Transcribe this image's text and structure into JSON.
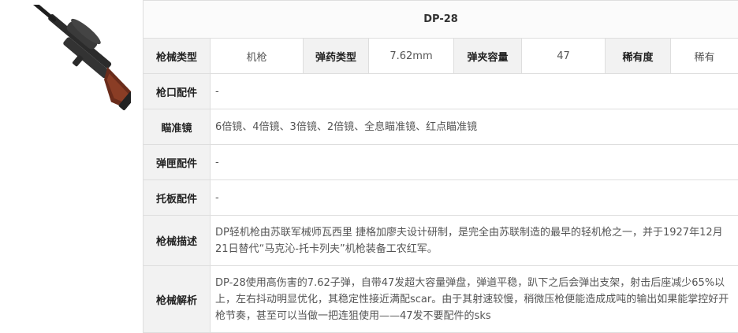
{
  "title": "DP-28",
  "stats": {
    "type_label": "枪械类型",
    "type_value": "机枪",
    "ammo_label": "弹药类型",
    "ammo_value": "7.62mm",
    "mag_label": "弹夹容量",
    "mag_value": "47",
    "rarity_label": "稀有度",
    "rarity_value": "稀有"
  },
  "rows": {
    "muzzle_label": "枪口配件",
    "muzzle_value": "-",
    "scope_label": "瞄准镜",
    "scope_value": "6倍镜、4倍镜、3倍镜、2倍镜、全息瞄准镜、红点瞄准镜",
    "mag_acc_label": "弹匣配件",
    "mag_acc_value": "-",
    "stock_label": "托板配件",
    "stock_value": "-",
    "desc_label": "枪械描述",
    "desc_value": "DP轻机枪由苏联军械师瓦西里 捷格加廖夫设计研制，是完全由苏联制造的最早的轻机枪之一，并于1927年12月21日替代“马克沁-托卡列夫”机枪装备工农红军。",
    "analysis_label": "枪械解析",
    "analysis_value": "DP-28使用高伤害的7.62子弹，自带47发超大容量弹盘，弹道平稳，趴下之后会弹出支架，射击后座减少65%以上，左右抖动明显优化，其稳定性接近满配scar。由于其射速较慢，稍微压枪便能造成成吨的输出如果能掌控好开枪节奏，甚至可以当做一把连狙使用——47发不要配件的sks"
  }
}
